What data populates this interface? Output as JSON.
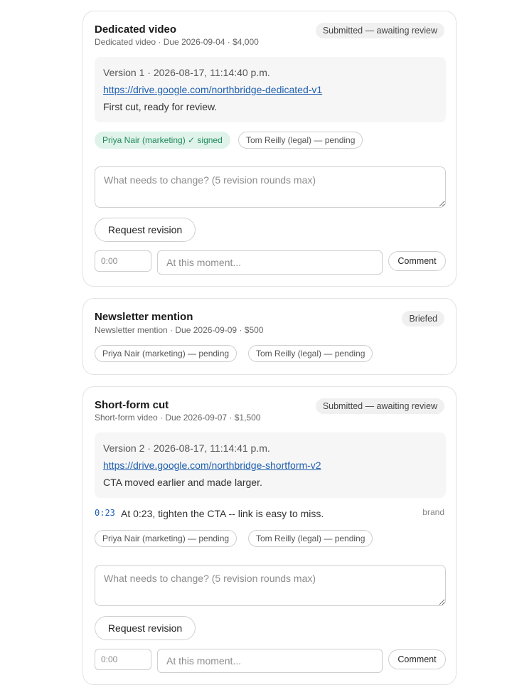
{
  "deliverables": [
    {
      "title": "Dedicated video",
      "meta": "Dedicated video · Due 2026-09-04 · $4,000",
      "status": "Submitted — awaiting review",
      "version": {
        "header": "Version 1 · 2026-08-17, 11:14:40 p.m.",
        "link": "https://drive.google.com/northbridge-dedicated-v1",
        "note": "First cut, ready for review."
      },
      "approvals": [
        "Priya Nair (marketing) ✓ signed",
        "Tom Reilly (legal) — pending"
      ],
      "feedback_placeholder": "What needs to change? (5 revision rounds max)",
      "request_revision_label": "Request revision",
      "time_placeholder": "0:00",
      "moment_placeholder": "At this moment...",
      "comment_label": "Comment"
    },
    {
      "title": "Newsletter mention",
      "meta": "Newsletter mention · Due 2026-09-09 · $500",
      "status": "Briefed",
      "approvals": [
        "Priya Nair (marketing) — pending",
        "Tom Reilly (legal) — pending"
      ]
    },
    {
      "title": "Short-form cut",
      "meta": "Short-form video · Due 2026-09-07 · $1,500",
      "status": "Submitted — awaiting review",
      "version": {
        "header": "Version 2 · 2026-08-17, 11:14:41 p.m.",
        "link": "https://drive.google.com/northbridge-shortform-v2",
        "note": "CTA moved earlier and made larger."
      },
      "comment": {
        "time": "0:23",
        "text": "At 0:23, tighten the CTA -- link is easy to miss.",
        "author": "brand"
      },
      "approvals": [
        "Priya Nair (marketing) — pending",
        "Tom Reilly (legal) — pending"
      ],
      "feedback_placeholder": "What needs to change? (5 revision rounds max)",
      "request_revision_label": "Request revision",
      "time_placeholder": "0:00",
      "moment_placeholder": "At this moment...",
      "comment_label": "Comment"
    }
  ]
}
